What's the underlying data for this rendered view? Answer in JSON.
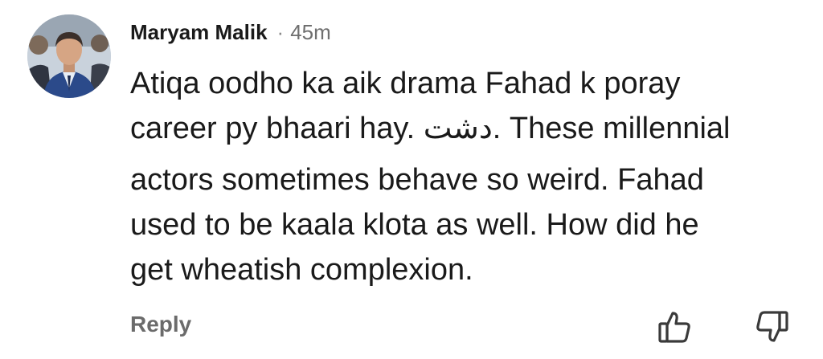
{
  "comment": {
    "author": "Maryam Malik",
    "separator": "·",
    "time": "45m",
    "text_lines": [
      "Atiqa oodho ka aik drama Fahad k poray",
      "career py bhaari hay. دشت. These millennial",
      "actors sometimes behave so weird. Fahad",
      "used to be kaala klota as well. How did he",
      "get wheatish complexion."
    ]
  },
  "actions": {
    "reply_label": "Reply",
    "upvote_icon": "thumbs-up-icon",
    "downvote_icon": "thumbs-down-icon"
  },
  "colors": {
    "text": "#1a1a1a",
    "muted": "#6b6b6b"
  }
}
